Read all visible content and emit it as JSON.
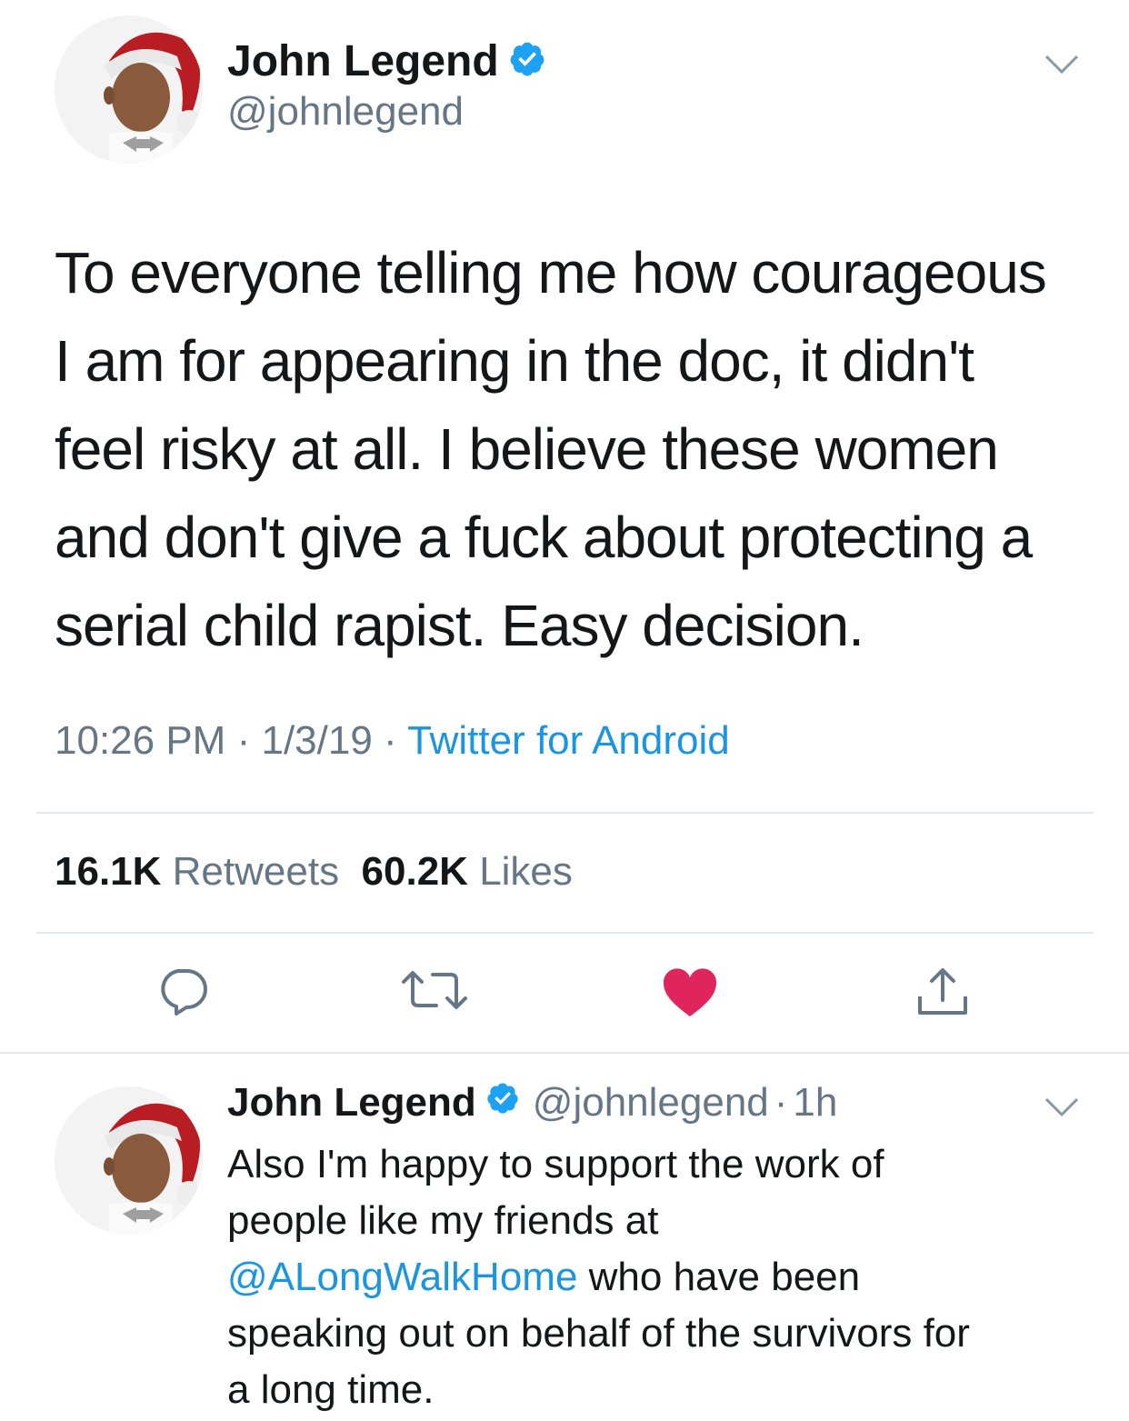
{
  "tweet": {
    "author_name": "John Legend",
    "author_handle": "@johnlegend",
    "text_lines": [
      "To everyone telling me how courageous",
      "I am for appearing in the doc, it didn't",
      "feel risky at all. I believe these women",
      "and don't give a fuck about protecting a",
      "serial child rapist. Easy decision."
    ],
    "time": "10:26 PM",
    "date": "1/3/19",
    "separator": "·",
    "source": "Twitter for Android",
    "retweets_count": "16.1K",
    "retweets_label": "Retweets",
    "likes_count": "60.2K",
    "likes_label": "Likes"
  },
  "actions": {
    "reply_icon": "reply-icon",
    "retweet_icon": "retweet-icon",
    "like_icon": "heart-icon",
    "share_icon": "share-icon"
  },
  "reply": {
    "author_name": "John Legend",
    "author_handle": "@johnlegend",
    "time_ago": "1h",
    "line1": "Also I'm happy to support the work of",
    "line2": "people like my friends at",
    "mention": "@ALongWalkHome",
    "line3_rest": " who have been",
    "line4": "speaking out on behalf of the survivors for",
    "line5": "a long time."
  },
  "colors": {
    "link": "#1b95e0",
    "secondary_text": "#657786",
    "like_red": "#e0245e",
    "verified_blue": "#1da1f2"
  }
}
